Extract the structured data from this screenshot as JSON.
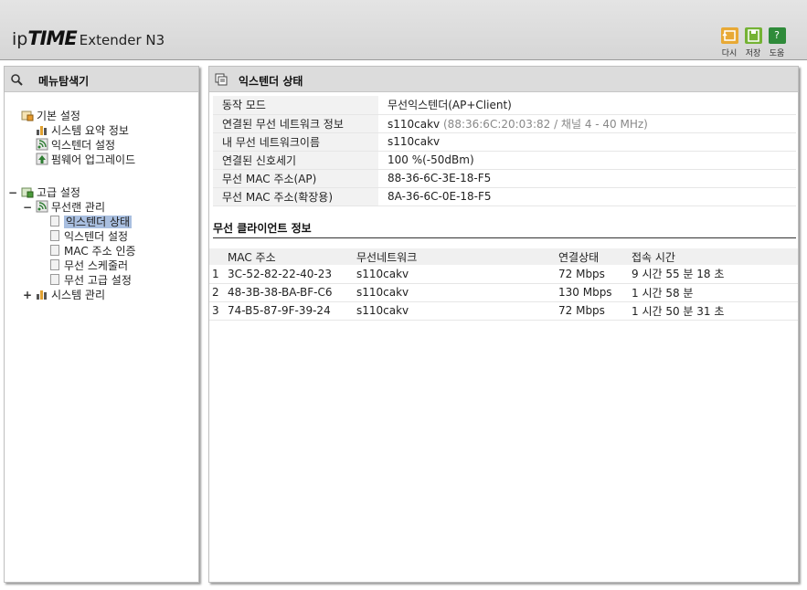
{
  "header": {
    "logo_ip": "ip",
    "logo_time": "TIME",
    "logo_model": "Extender N3",
    "buttons": {
      "reload": "다시",
      "save": "저장",
      "help": "도움",
      "help_glyph": "?"
    }
  },
  "sidebar": {
    "title": "메뉴탐색기",
    "groups": [
      {
        "label": "기본 설정",
        "items": [
          {
            "label": "시스템 요약 정보"
          },
          {
            "label": "익스텐더 설정"
          },
          {
            "label": "펌웨어 업그레이드"
          }
        ]
      },
      {
        "label": "고급 설정",
        "expander": "−",
        "subgroups": [
          {
            "label": "무선랜 관리",
            "expander": "−",
            "items": [
              {
                "label": "익스텐더 상태"
              },
              {
                "label": "익스텐더 설정"
              },
              {
                "label": "MAC 주소 인증"
              },
              {
                "label": "무선 스케줄러"
              },
              {
                "label": "무선 고급 설정"
              }
            ]
          },
          {
            "label": "시스템 관리",
            "expander": "+"
          }
        ]
      }
    ]
  },
  "main": {
    "title": "익스텐더 상태",
    "status_rows": [
      {
        "label": "동작 모드",
        "value": "무선익스텐더(AP+Client)",
        "extra": ""
      },
      {
        "label": "연결된 무선 네트워크 정보",
        "value": "s110cakv",
        "extra": "(88:36:6C:20:03:82 / 채널 4 - 40 MHz)"
      },
      {
        "label": "내 무선 네트워크이름",
        "value": "s110cakv",
        "extra": ""
      },
      {
        "label": "연결된 신호세기",
        "value": "100 %(-50dBm)",
        "extra": ""
      },
      {
        "label": "무선 MAC 주소(AP)",
        "value": "88-36-6C-3E-18-F5",
        "extra": ""
      },
      {
        "label": "무선 MAC 주소(확장용)",
        "value": "8A-36-6C-0E-18-F5",
        "extra": ""
      }
    ],
    "clients_title": "무선 클라이언트 정보",
    "clients_headers": [
      "MAC 주소",
      "무선네트워크",
      "연결상태",
      "접속 시간"
    ],
    "clients": [
      {
        "index": "1",
        "mac": "3C-52-82-22-40-23",
        "network": "s110cakv",
        "status": "72 Mbps",
        "time": "9 시간 55 분 18 초"
      },
      {
        "index": "2",
        "mac": "48-3B-38-BA-BF-C6",
        "network": "s110cakv",
        "status": "130 Mbps",
        "time": "1 시간 58 분"
      },
      {
        "index": "3",
        "mac": "74-B5-87-9F-39-24",
        "network": "s110cakv",
        "status": "72 Mbps",
        "time": "1 시간 50 분 31 초"
      }
    ]
  }
}
